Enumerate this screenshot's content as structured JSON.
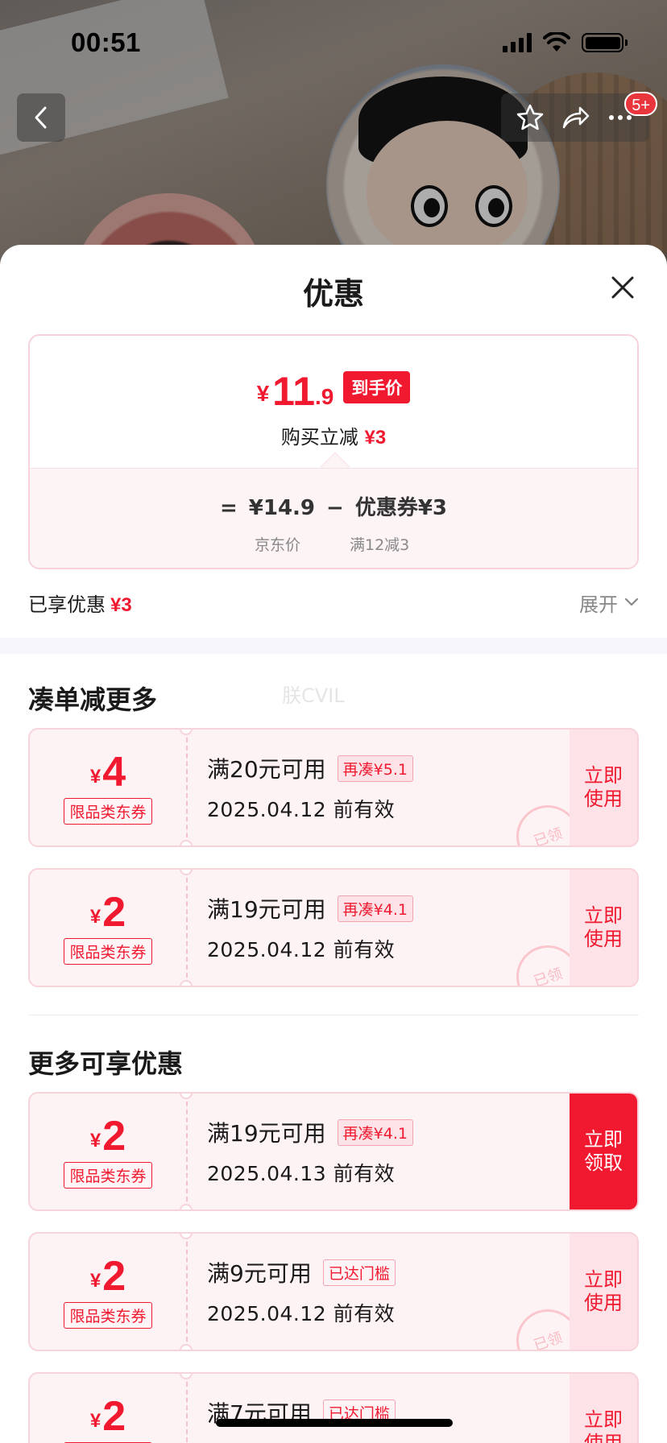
{
  "status_bar": {
    "time": "00:51"
  },
  "nav": {
    "badge": "5+"
  },
  "sheet": {
    "title": "优惠"
  },
  "price_summary": {
    "currency": "¥",
    "final_int": "11",
    "final_dec": ".9",
    "tag": "到手价",
    "instant_cut_label": "购买立减",
    "instant_cut_value": "¥3",
    "equals": "=",
    "base_price": "¥14.9",
    "minus": "−",
    "coupon_part": "优惠券¥3",
    "base_label": "京东价",
    "coupon_label": "满12减3"
  },
  "enjoyed": {
    "label": "已享优惠",
    "value": "¥3",
    "expand_label": "展开"
  },
  "section_more_orders": "凑单减更多",
  "watermark": "朕CVIL",
  "section_more_offers": "更多可享优惠",
  "coupons": [
    {
      "amount": "4",
      "type": "限品类东券",
      "condition": "满20元可用",
      "hint": "再凑¥5.1",
      "valid": "2025.04.12 前有效",
      "action": "立即使用",
      "stamp": "已领"
    },
    {
      "amount": "2",
      "type": "限品类东券",
      "condition": "满19元可用",
      "hint": "再凑¥4.1",
      "valid": "2025.04.12 前有效",
      "action": "立即使用",
      "stamp": "已领"
    },
    {
      "amount": "2",
      "type": "限品类东券",
      "condition": "满19元可用",
      "hint": "再凑¥4.1",
      "valid": "2025.04.13 前有效",
      "action": "立即领取"
    },
    {
      "amount": "2",
      "type": "限品类东券",
      "condition": "满9元可用",
      "hint": "已达门槛",
      "valid": "2025.04.12 前有效",
      "action": "立即使用",
      "stamp": "已领"
    },
    {
      "amount": "2",
      "type": "限品类东券",
      "condition": "满7元可用",
      "hint": "已达门槛",
      "valid": "",
      "action": "立即使用"
    }
  ],
  "colors": {
    "accent": "#f0192f",
    "coupon_bg": "#fdf2f4",
    "coupon_border": "#f7d3da"
  }
}
